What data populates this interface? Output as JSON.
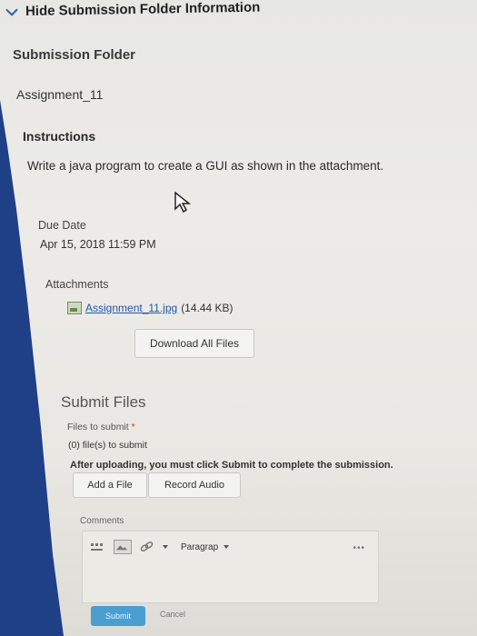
{
  "header": {
    "hide_label": "Hide Submission Folder Information"
  },
  "folder": {
    "title": "Submission Folder",
    "name": "Assignment_11",
    "instructions_title": "Instructions",
    "instructions_text": "Write a java program to create a GUI as shown in the attachment.",
    "due_label": "Due Date",
    "due_value": "Apr 15, 2018 11:59 PM",
    "attachments_label": "Attachments",
    "attachment": {
      "name": "Assignment_11.jpg",
      "size": "(14.44 KB)"
    },
    "download_label": "Download All Files"
  },
  "submit": {
    "title": "Submit Files",
    "files_label": "Files to submit",
    "required_marker": "*",
    "files_count": "(0) file(s) to submit",
    "notice": "After uploading, you must click Submit to complete the submission.",
    "add_file": "Add a File",
    "record_audio": "Record Audio",
    "comments_label": "Comments",
    "paragraph_select": "Paragrap",
    "more": "•••",
    "submit_label": "Submit",
    "cancel_label": "Cancel"
  },
  "colors": {
    "background": "#1f3f87",
    "panel": "#e9e8e3",
    "link": "#1f5aa6",
    "submit_button": "#4a9fd0"
  }
}
